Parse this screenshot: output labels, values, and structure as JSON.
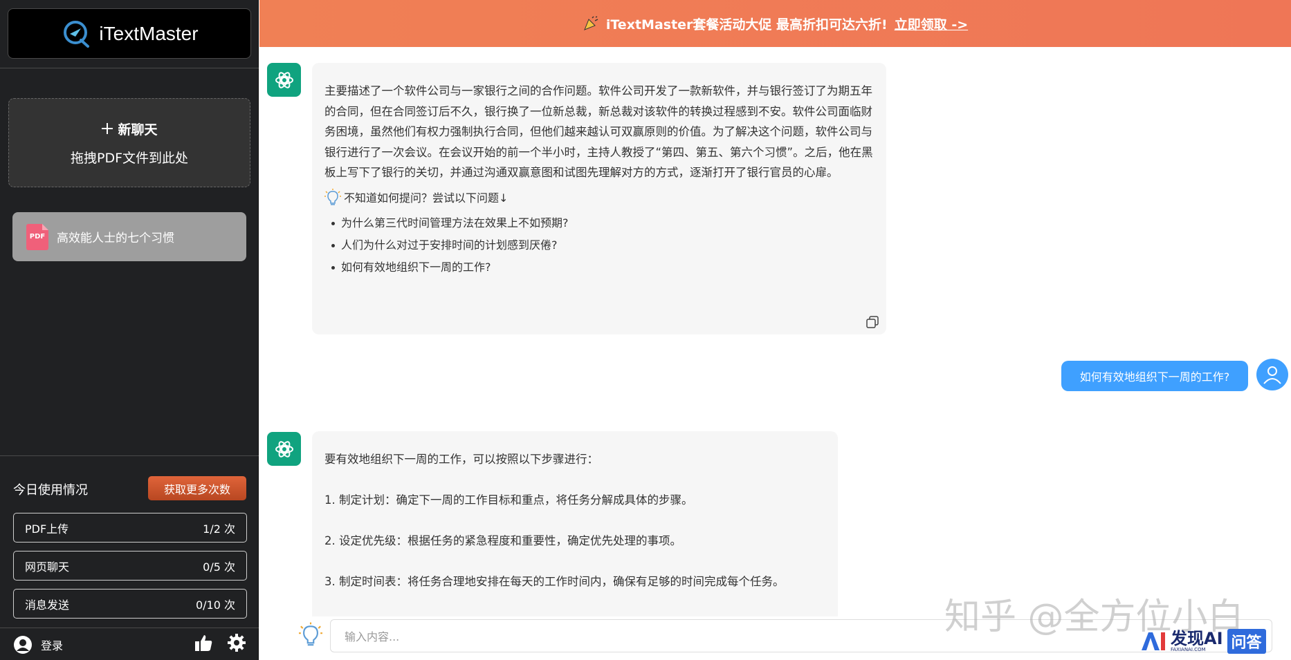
{
  "app": {
    "name": "iTextMaster"
  },
  "sidebar": {
    "new_chat_label": "新聊天",
    "drop_hint": "拖拽PDF文件到此处",
    "files": [
      {
        "badge": "PDF",
        "name": "高效能人士的七个习惯"
      }
    ],
    "usage": {
      "title": "今日使用情况",
      "more_button": "获取更多次数",
      "rows": [
        {
          "label": "PDF上传",
          "value": "1/2 次"
        },
        {
          "label": "网页聊天",
          "value": "0/5 次"
        },
        {
          "label": "消息发送",
          "value": "0/10 次"
        }
      ]
    },
    "footer": {
      "login_label": "登录"
    }
  },
  "banner": {
    "text": "iTextMaster套餐活动大促 最高折扣可达六折!",
    "link": "立即领取 ->"
  },
  "chat": {
    "summary": "主要描述了一个软件公司与一家银行之间的合作问题。软件公司开发了一款新软件，并与银行签订了为期五年的合同，但在合同签订后不久，银行换了一位新总裁，新总裁对该软件的转换过程感到不安。软件公司面临财务困境，虽然他们有权力强制执行合同，但他们越来越认可双赢原则的价值。为了解决这个问题，软件公司与银行进行了一次会议。在会议开始的前一个半小时，主持人教授了“第四、第五、第六个习惯”。之后，他在黑板上写下了银行的关切，并通过沟通双赢意图和试图先理解对方的方式，逐渐打开了银行官员的心扉。",
    "hint": "不知道如何提问？尝试以下问题↓",
    "suggestions": [
      "为什么第三代时间管理方法在效果上不如预期?",
      "人们为什么对过于安排时间的计划感到厌倦?",
      "如何有效地组织下一周的工作?"
    ],
    "user_message": "如何有效地组织下一周的工作?",
    "answer": [
      "要有效地组织下一周的工作，可以按照以下步骤进行：",
      "1. 制定计划：确定下一周的工作目标和重点，将任务分解成具体的步骤。",
      "2. 设定优先级：根据任务的紧急程度和重要性，确定优先处理的事项。",
      "3. 制定时间表：将任务合理地安排在每天的工作时间内，确保有足够的时间完成每个任务。"
    ]
  },
  "input": {
    "placeholder": "输入内容..."
  },
  "watermark": {
    "zhihu": "知乎 @全方位小白",
    "ai_brand": "发现AI",
    "ai_domain": "FAXIANAI.COM",
    "ai_ask": "问答"
  },
  "colors": {
    "accent": "#3fa0ff",
    "bot": "#10a37f",
    "banner": "#f08055",
    "sidebar": "#202123"
  }
}
